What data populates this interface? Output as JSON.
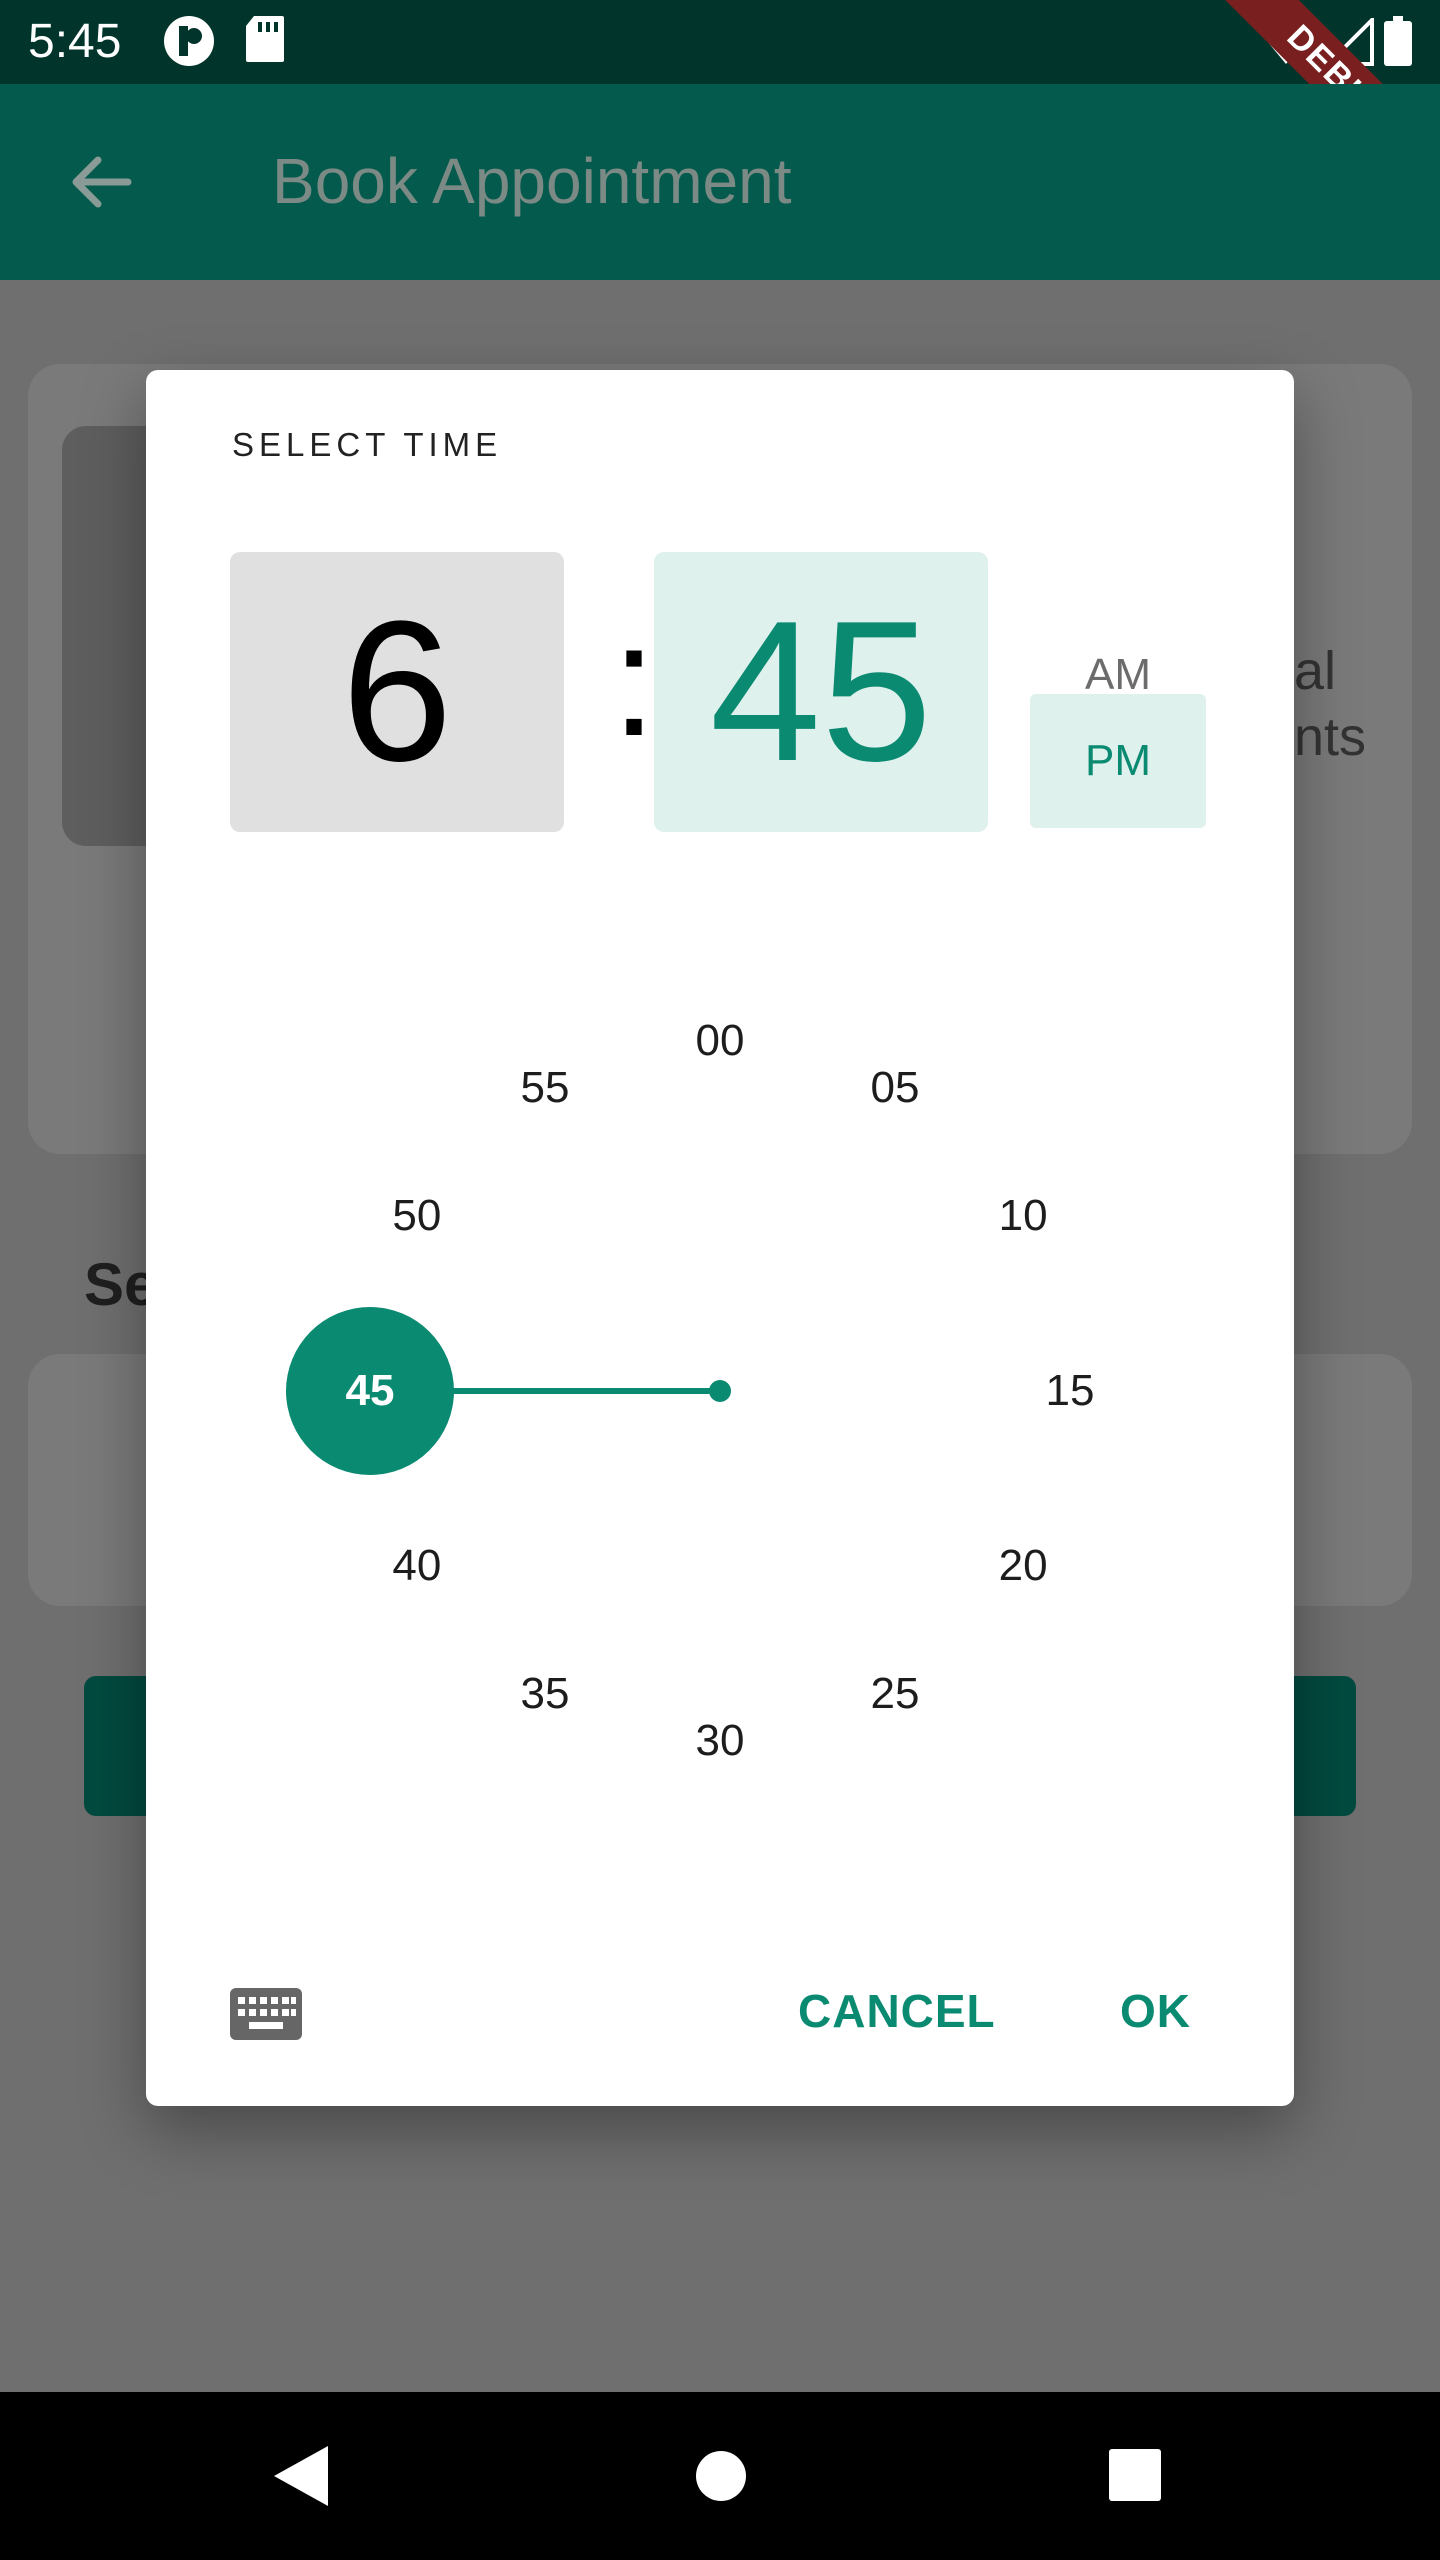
{
  "status_bar": {
    "time": "5:45",
    "icons": [
      "play-store-icon",
      "sd-card-icon",
      "wifi-icon",
      "signal-icon",
      "battery-icon"
    ],
    "debug_label": "DEBUG"
  },
  "app_bar": {
    "title": "Book Appointment",
    "back_icon": "arrow-back-icon"
  },
  "background": {
    "card_text_line1": "al",
    "card_text_line2": "nts",
    "section_heading_partial": "Se"
  },
  "time_picker": {
    "title": "SELECT TIME",
    "hour": "6",
    "separator": ":",
    "minute": "45",
    "am_label": "AM",
    "pm_label": "PM",
    "period_selected": "PM",
    "dial_numbers": [
      "00",
      "05",
      "10",
      "15",
      "20",
      "25",
      "30",
      "35",
      "40",
      "45",
      "50",
      "55"
    ],
    "selected_minute": "45",
    "keyboard_icon": "keyboard-icon",
    "cancel_label": "CANCEL",
    "ok_label": "OK"
  },
  "colors": {
    "accent": "#0b8a72",
    "app_bar": "#045a4c",
    "status_bar": "#01352c",
    "selected_bg": "#dff1ed"
  }
}
